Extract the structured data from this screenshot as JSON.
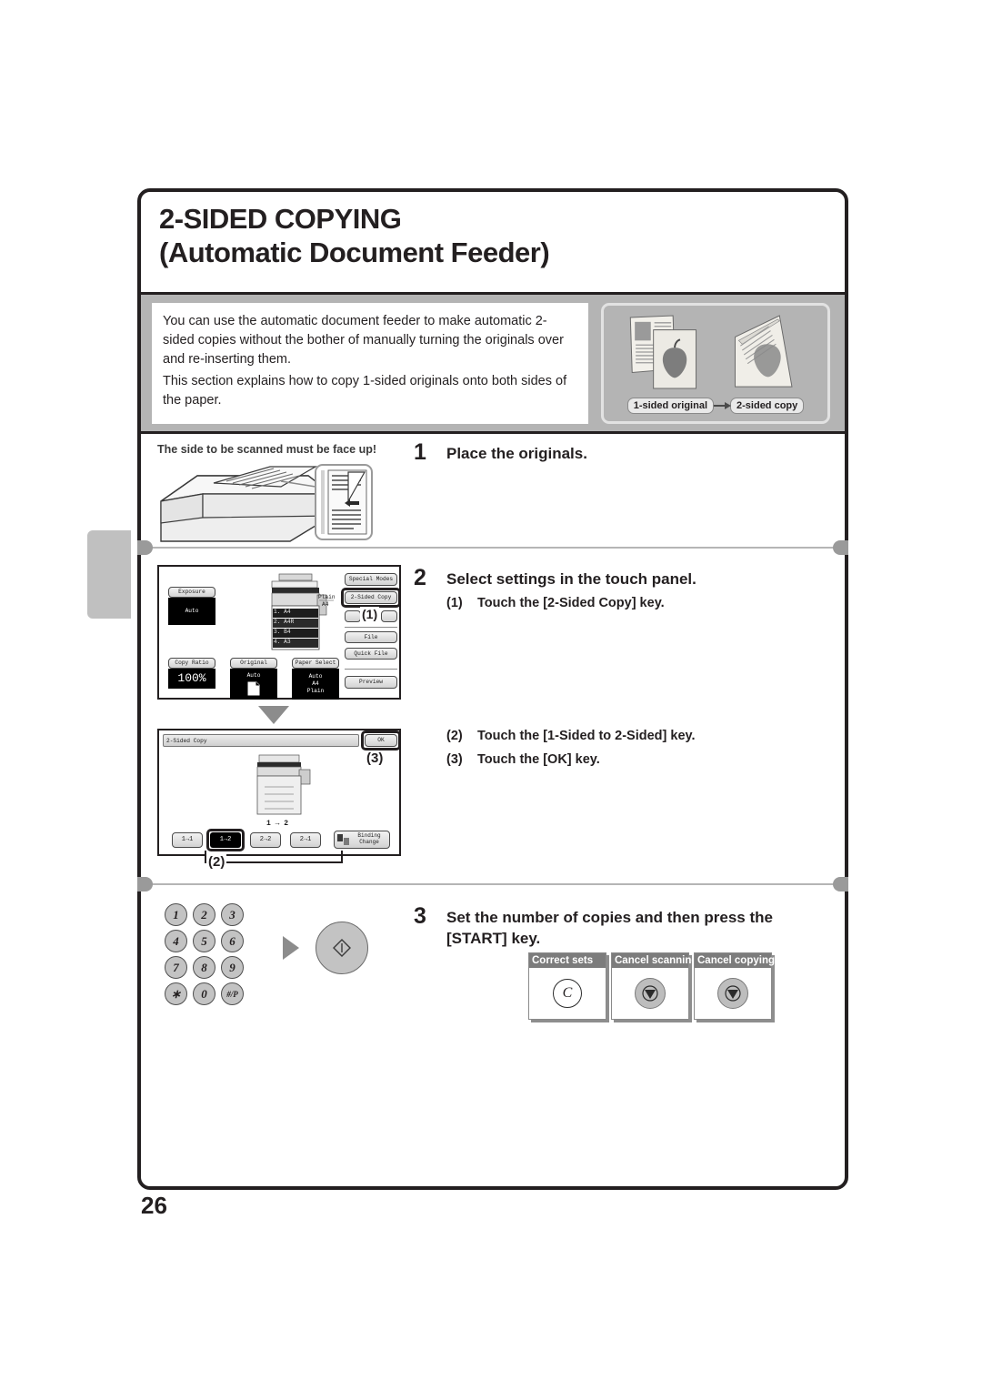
{
  "page": {
    "number": "26",
    "title_line1": "2-SIDED COPYING",
    "title_line2": "(Automatic Document Feeder)"
  },
  "intro": {
    "paragraph1": "You can use the automatic document feeder to make automatic 2-sided copies without the bother of manually turning the originals over and re-inserting them.",
    "paragraph2": "This section explains how to copy 1-sided originals onto both sides of the paper.",
    "figure": {
      "left_label": "1-sided original",
      "arrow_icon": "arrow-right-icon",
      "right_label": "2-sided copy"
    }
  },
  "steps": [
    {
      "number": "1",
      "heading": "Place the originals.",
      "illustration_caption": "The side to be scanned must be face up!"
    },
    {
      "number": "2",
      "heading": "Select settings in the touch panel.",
      "substeps": [
        {
          "marker": "(1)",
          "text": "Touch the [2-Sided Copy] key."
        },
        {
          "marker": "(2)",
          "text": "Touch the [1-Sided to 2-Sided] key."
        },
        {
          "marker": "(3)",
          "text": "Touch the [OK] key."
        }
      ]
    },
    {
      "number": "3",
      "heading": "Set the number of copies and then press the [START] key."
    }
  ],
  "panel_base": {
    "buttons_right": [
      "Special Modes",
      "2-Sided Copy",
      "File",
      "Quick File",
      "Preview"
    ],
    "exposure": {
      "label": "Exposure",
      "value": "Auto"
    },
    "copy_ratio": {
      "label": "Copy Ratio",
      "value": "100%"
    },
    "original": {
      "label": "Original",
      "value": "Auto",
      "size_icon_text": "A4"
    },
    "paper_select": {
      "label": "Paper Select",
      "lines": [
        "Auto",
        "A4",
        "Plain"
      ]
    },
    "tray_callout": [
      "Plain",
      "A4"
    ],
    "tray_list": [
      "1.  A4",
      "2.  A4R",
      "3.  B4",
      "4.  A3"
    ],
    "callout_1": "(1)"
  },
  "panel_dialog": {
    "title": "2-Sided Copy",
    "ok_label": "OK",
    "preview_caption": "1 → 2",
    "mode_buttons": [
      "1→1",
      "1→2",
      "2→2",
      "2→1"
    ],
    "binding_change_label": "Binding Change",
    "callout_2": "(2)",
    "callout_3": "(3)"
  },
  "keypad": {
    "keys": [
      "1",
      "2",
      "3",
      "4",
      "5",
      "6",
      "7",
      "8",
      "9",
      "∗",
      "0",
      "#/P"
    ],
    "arrow_icon": "play-triangle-icon",
    "start_icon": "start-diamond-icon"
  },
  "key_cards": [
    {
      "label": "Correct sets",
      "icon": "clear-c-icon",
      "glyph": "C"
    },
    {
      "label": "Cancel scanning",
      "icon": "stop-icon",
      "glyph": ""
    },
    {
      "label": "Cancel copying",
      "icon": "stop-icon",
      "glyph": ""
    }
  ],
  "colors": {
    "ink": "#231f20",
    "band": "#b4b4b4",
    "key_gray": "#c3c3c3",
    "card_header": "#7c7c7c"
  }
}
